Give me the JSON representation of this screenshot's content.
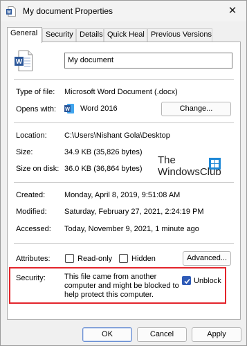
{
  "window": {
    "title": "My document Properties",
    "close_glyph": "✕"
  },
  "tabs": [
    {
      "label": "General",
      "active": true
    },
    {
      "label": "Security"
    },
    {
      "label": "Details"
    },
    {
      "label": "Quick Heal"
    },
    {
      "label": "Previous Versions"
    }
  ],
  "file_name": "My document",
  "type_of_file": {
    "label": "Type of file:",
    "value": "Microsoft Word Document (.docx)"
  },
  "opens_with": {
    "label": "Opens with:",
    "app": "Word 2016",
    "change_button": "Change..."
  },
  "location": {
    "label": "Location:",
    "value": "C:\\Users\\Nishant Gola\\Desktop"
  },
  "size": {
    "label": "Size:",
    "value": "34.9 KB (35,826 bytes)"
  },
  "size_on_disk": {
    "label": "Size on disk:",
    "value": "36.0 KB (36,864 bytes)"
  },
  "watermark": {
    "line1": "The",
    "line2": "WindowsClub"
  },
  "created": {
    "label": "Created:",
    "value": "Monday, April 8, 2019, 9:51:08 AM"
  },
  "modified": {
    "label": "Modified:",
    "value": "Saturday, February 27, 2021, 2:24:19 PM"
  },
  "accessed": {
    "label": "Accessed:",
    "value": "Today, November 9, 2021, 1 minute ago"
  },
  "attributes": {
    "label": "Attributes:",
    "read_only": {
      "label": "Read-only",
      "checked": false
    },
    "hidden": {
      "label": "Hidden",
      "checked": false
    },
    "advanced_button": "Advanced..."
  },
  "security": {
    "label": "Security:",
    "message": "This file came from another computer and might be blocked to help protect this computer.",
    "unblock": {
      "label": "Unblock",
      "checked": true
    }
  },
  "footer": {
    "ok": "OK",
    "cancel": "Cancel",
    "apply": "Apply"
  },
  "colors": {
    "accent": "#2f5bb7",
    "highlight_border": "#e3242b",
    "word_blue": "#2b579a"
  }
}
